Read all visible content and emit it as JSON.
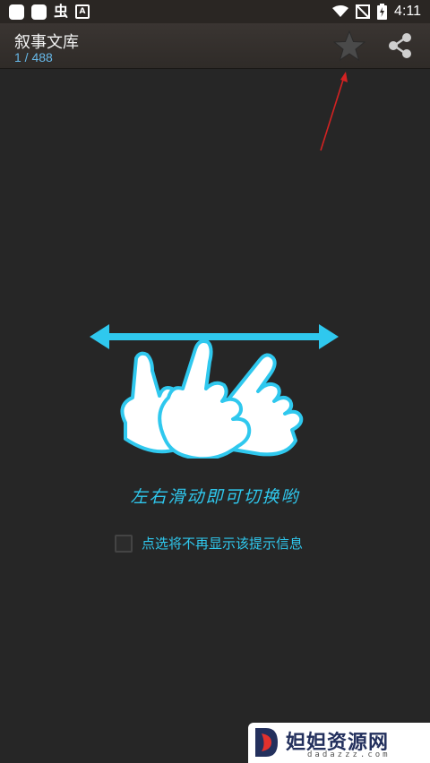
{
  "status_bar": {
    "time": "4:11",
    "glyph": "虫",
    "a_badge": "A"
  },
  "header": {
    "title": "叙事文库",
    "page_counter": "1 / 488"
  },
  "guide": {
    "hint": "左右滑动即可切换哟",
    "dont_show_label": "点选将不再显示该提示信息"
  },
  "watermark": {
    "name": "妲妲资源网",
    "site": "dadazzz.com"
  },
  "colors": {
    "accent": "#2fc8ee",
    "counter": "#67b8e8",
    "background": "#262626",
    "annotation": "#d32222"
  },
  "icons": [
    "star-icon",
    "share-icon",
    "wifi-icon",
    "battery-icon",
    "mute-icon"
  ]
}
